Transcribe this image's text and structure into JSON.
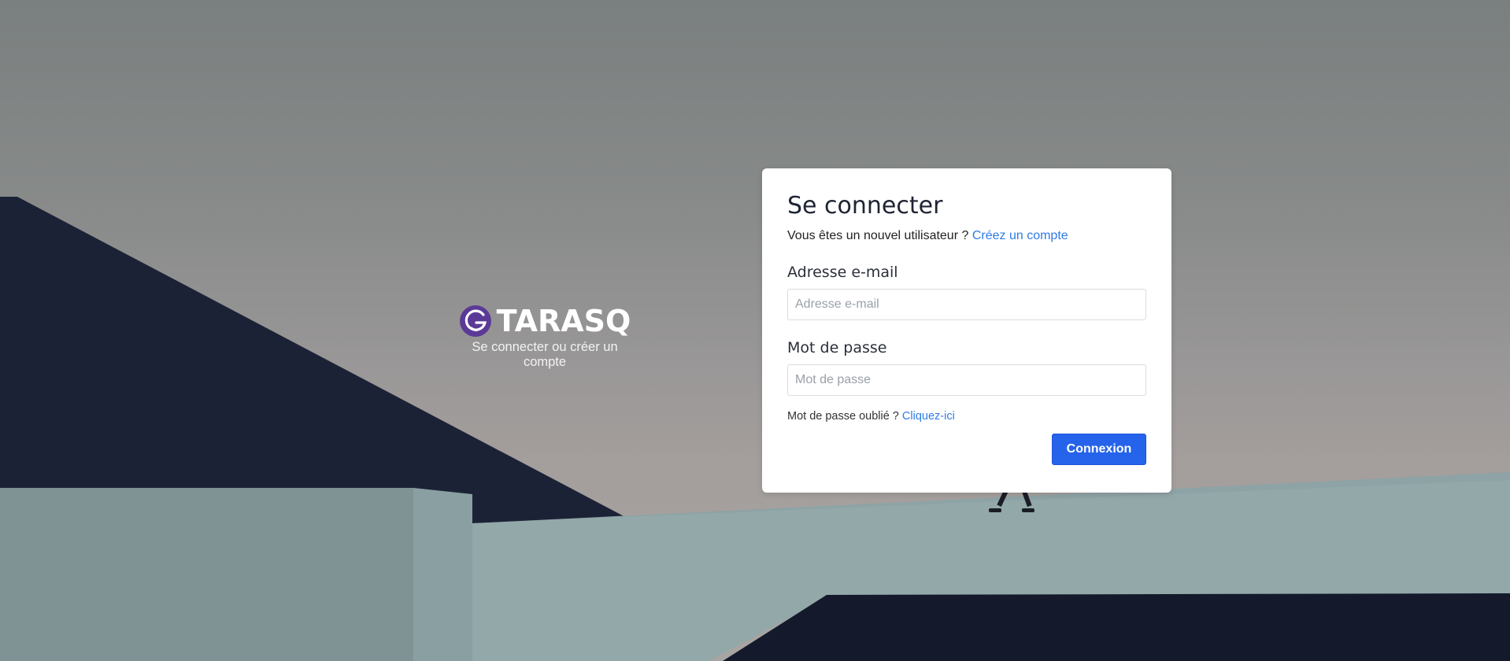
{
  "brand": {
    "name": "TARASQ",
    "tagline": "Se connecter ou créer un compte",
    "accent": "#5b3a97"
  },
  "login": {
    "title": "Se connecter",
    "new_user_text": "Vous êtes un nouvel utilisateur ?",
    "create_account_link": "Créez un compte",
    "email_label": "Adresse e-mail",
    "email_placeholder": "Adresse e-mail",
    "password_label": "Mot de passe",
    "password_placeholder": "Mot de passe",
    "forgot_text": "Mot de passe oublié ?",
    "forgot_link": "Cliquez-ici",
    "submit_label": "Connexion",
    "link_color": "#2f7be5",
    "button_color": "#2563eb"
  }
}
